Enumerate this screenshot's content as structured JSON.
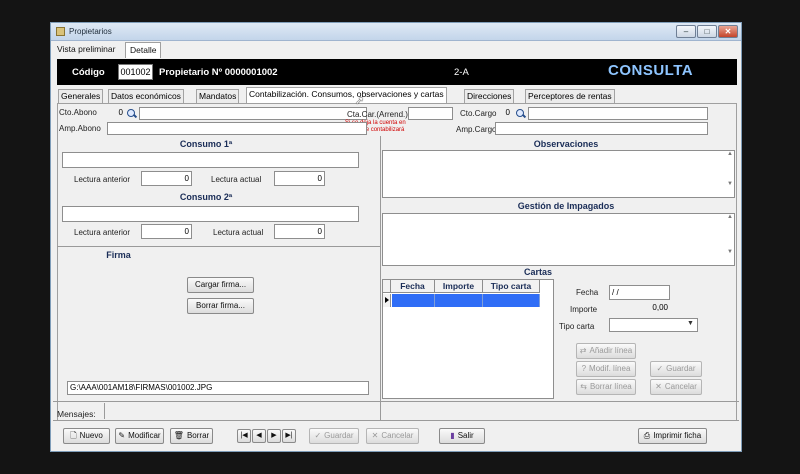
{
  "window": {
    "title": "Propietarios",
    "controls": {
      "minimize": "‒",
      "maximize": "□",
      "close": "✕"
    }
  },
  "top_tabs": [
    "Vista preliminar",
    "Detalle"
  ],
  "header": {
    "codigo_label": "Código",
    "codigo_value": "001002",
    "propietario_label": "Propietario Nº 0000001002",
    "unit": "2-A",
    "mode": "CONSULTA"
  },
  "sub_tabs": [
    "Generales",
    "Datos económicos",
    "Mandatos",
    "Contabilización. Consumos, observaciones y cartas",
    "Direcciones",
    "Perceptores de rentas"
  ],
  "accounts": {
    "cto_abono_label": "Cto.Abono",
    "cto_abono_value": "0",
    "amp_abono_label": "Amp.Abono",
    "cta_car_label": "Cta.Car.(Arrend.)",
    "cta_note_line1": "Si se deja la cuenta en",
    "cta_note_line2": "blanco no se contabilizará",
    "cto_cargo_label": "Cto.Cargo",
    "cto_cargo_value": "0",
    "amp_cargo_label": "Amp.Cargo"
  },
  "consumo1": {
    "title": "Consumo 1ª",
    "lectura_anterior_label": "Lectura anterior",
    "lectura_anterior_value": "0",
    "lectura_actual_label": "Lectura actual",
    "lectura_actual_value": "0"
  },
  "consumo2": {
    "title": "Consumo 2ª",
    "lectura_anterior_label": "Lectura anterior",
    "lectura_anterior_value": "0",
    "lectura_actual_label": "Lectura actual",
    "lectura_actual_value": "0"
  },
  "observaciones_title": "Observaciones",
  "impagados_title": "Gestión de Impagados",
  "firma": {
    "title": "Firma",
    "cargar_label": "Cargar firma...",
    "borrar_label": "Borrar firma...",
    "path": "G:\\AAA\\001AM18\\FIRMAS\\001002.JPG"
  },
  "cartas": {
    "title": "Cartas",
    "columns": [
      "Fecha",
      "Importe",
      "Tipo carta"
    ],
    "fecha_label": "Fecha",
    "fecha_value": "/ /",
    "importe_label": "Importe",
    "importe_value": "0,00",
    "tipo_label": "Tipo carta",
    "tipo_value": "",
    "anadir_label": "Añadir línea",
    "modif_label": "Modif. línea",
    "borrar_label": "Borrar línea",
    "guardar_label": "Guardar",
    "cancelar_label": "Cancelar"
  },
  "status": {
    "mensajes_label": "Mensajes:"
  },
  "toolbar": {
    "nuevo": "Nuevo",
    "modificar": "Modificar",
    "borrar": "Borrar",
    "nav_first": "|◀",
    "nav_prev": "◀",
    "nav_next": "▶",
    "nav_last": "▶|",
    "guardar": "Guardar",
    "cancelar": "Cancelar",
    "salir": "Salir",
    "imprimir": "Imprimir ficha"
  },
  "colors": {
    "header_bg": "#000000",
    "consulta_text": "#8ec5ff",
    "selection_blue": "#2f6df6",
    "section_title": "#1a2d57",
    "warning_red": "#d00000"
  }
}
